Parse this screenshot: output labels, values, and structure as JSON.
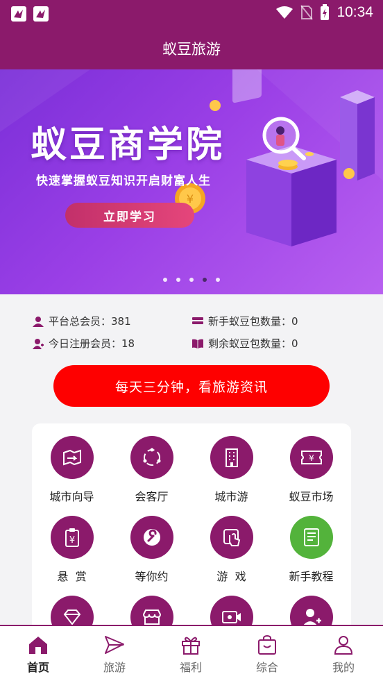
{
  "status_bar": {
    "time": "10:34"
  },
  "header": {
    "title": "蚁豆旅游"
  },
  "banner": {
    "title": "蚁豆商学院",
    "subtitle": "快速掌握蚁豆知识开启财富人生",
    "button_label": "立即学习",
    "dots_count": 5,
    "active_dot": 3
  },
  "stats": {
    "total_members": "平台总会员：381",
    "today_registered": "今日注册会员：18",
    "newbie_packs": "新手蚁豆包数量：0",
    "remaining_packs": "剩余蚁豆包数量：0"
  },
  "cta": {
    "label": "每天三分钟，看旅游资讯"
  },
  "grid": {
    "items": [
      {
        "label": "城市向导",
        "icon": "map-icon"
      },
      {
        "label": "会客厅",
        "icon": "circle-dots-icon"
      },
      {
        "label": "城市游",
        "icon": "building-icon"
      },
      {
        "label": "蚁豆市场",
        "icon": "ticket-icon"
      },
      {
        "label": "悬  赏",
        "icon": "clipboard-yen-icon"
      },
      {
        "label": "等你约",
        "icon": "wrench-icon"
      },
      {
        "label": "游  戏",
        "icon": "touch-icon"
      },
      {
        "label": "新手教程",
        "icon": "book-icon"
      },
      {
        "label": "",
        "icon": "diamond-icon"
      },
      {
        "label": "",
        "icon": "store-icon"
      },
      {
        "label": "",
        "icon": "video-icon"
      },
      {
        "label": "",
        "icon": "add-user-icon"
      }
    ]
  },
  "tabs": [
    {
      "label": "首页",
      "icon": "home-icon",
      "active": true
    },
    {
      "label": "旅游",
      "icon": "paper-plane-icon"
    },
    {
      "label": "福利",
      "icon": "gift-icon"
    },
    {
      "label": "综合",
      "icon": "bag-icon"
    },
    {
      "label": "我的",
      "icon": "user-icon"
    }
  ],
  "colors": {
    "brand": "#8b1a6b",
    "cta": "#fe0000",
    "accent_green": "#53b33b",
    "banner": "#8a3ce0"
  }
}
